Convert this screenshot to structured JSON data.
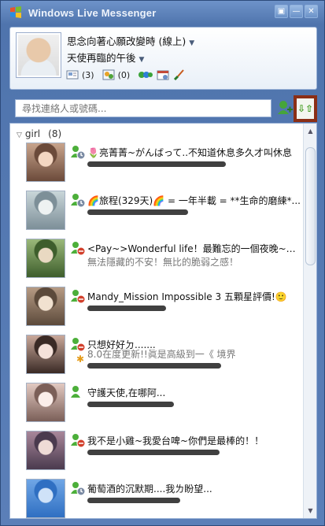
{
  "app": {
    "title": "Windows Live Messenger"
  },
  "window_buttons": [
    "▣",
    "—",
    "✕"
  ],
  "user": {
    "name": "思念向著心願改變時  (線上)",
    "personal_message": "天使再臨的午後",
    "mail_count": "(3)",
    "space_count": "(0)"
  },
  "search": {
    "placeholder": "尋找連絡人或號碼..."
  },
  "group": {
    "name": "girl",
    "count": "(8)"
  },
  "contacts": [
    {
      "name": "🌷亮菁菁~がんばって..不知道休息多久才叫休息",
      "sub": "",
      "status": "idle",
      "photo": [
        "#6b4a3a",
        "#c8a48c",
        "#f4d7c2"
      ]
    },
    {
      "name": "🌈旅程(329天)🌈 = 一年半載 = **生命的磨練*...",
      "sub": "",
      "status": "idle",
      "photo": [
        "#7d8f98",
        "#c9d6d9",
        "#eef2f2"
      ]
    },
    {
      "name": "<Pay~>Wonderful life！最難忘的一個夜晚~！關...",
      "sub": "無法隱藏的不安！無比的脆弱之感！",
      "status": "busy",
      "photo": [
        "#3e5e2c",
        "#9ab87a",
        "#e9d9c2"
      ]
    },
    {
      "name": "Mandy_Mission Impossible 3 五顆星評價!🙂",
      "sub": "",
      "status": "busy",
      "photo": [
        "#5c4a3b",
        "#b69b84",
        "#f1e1d0"
      ]
    },
    {
      "name": "只想好好ㄉ.......",
      "sub": "8.0在度更新!!眞是高級到一《 境界",
      "status": "busy",
      "photo": [
        "#3a2a25",
        "#c9a89a",
        "#f5e2da"
      ]
    },
    {
      "name": "守護天使,在哪阿...",
      "sub": "",
      "status": "online",
      "photo": [
        "#7b5f58",
        "#e2c9c1",
        "#fbeeea"
      ]
    },
    {
      "name": "我不是小雞~我愛台啤~你們是最棒的！！",
      "sub": "",
      "status": "busy",
      "photo": [
        "#4a3a4e",
        "#a8879a",
        "#eedbd6"
      ]
    },
    {
      "name": "葡萄酒的沉默期....我ㄌ盼望...",
      "sub": "",
      "status": "idle",
      "photo": [
        "#2f6fc2",
        "#6fa6e6",
        "#cfe2f8"
      ]
    }
  ],
  "colors": {
    "accent": "#5b7fb8",
    "highlight_box": "#8b2f16"
  }
}
